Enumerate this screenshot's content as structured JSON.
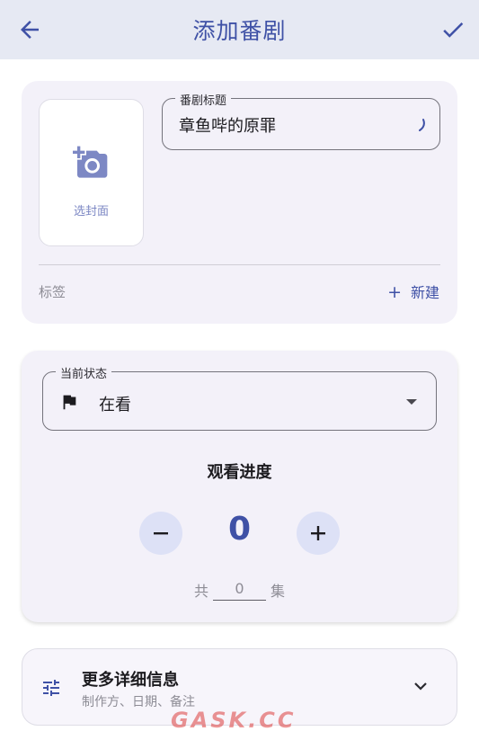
{
  "appbar": {
    "title": "添加番剧",
    "back_icon": "arrow-left-icon",
    "confirm_icon": "check-icon"
  },
  "cover": {
    "label": "选封面",
    "icon": "add-photo-icon"
  },
  "title_field": {
    "label": "番剧标题",
    "value": "章鱼哔的原罪"
  },
  "tags": {
    "label": "标签",
    "new_label": "新建",
    "new_icon": "plus"
  },
  "status_field": {
    "label": "当前状态",
    "value": "在看",
    "icon": "flag-icon"
  },
  "progress": {
    "title": "观看进度",
    "count": "0",
    "total_prefix": "共",
    "total_value": "0",
    "total_suffix": "集"
  },
  "more": {
    "title": "更多详细信息",
    "subtitle": "制作方、日期、备注",
    "icon": "tune-icon"
  },
  "watermark": "GASK.CC",
  "colors": {
    "accent": "#3f51a6",
    "appbar_bg": "#e6e9f3",
    "card_bg": "#f3f1f9",
    "round_btn_bg": "#dde1f6"
  }
}
